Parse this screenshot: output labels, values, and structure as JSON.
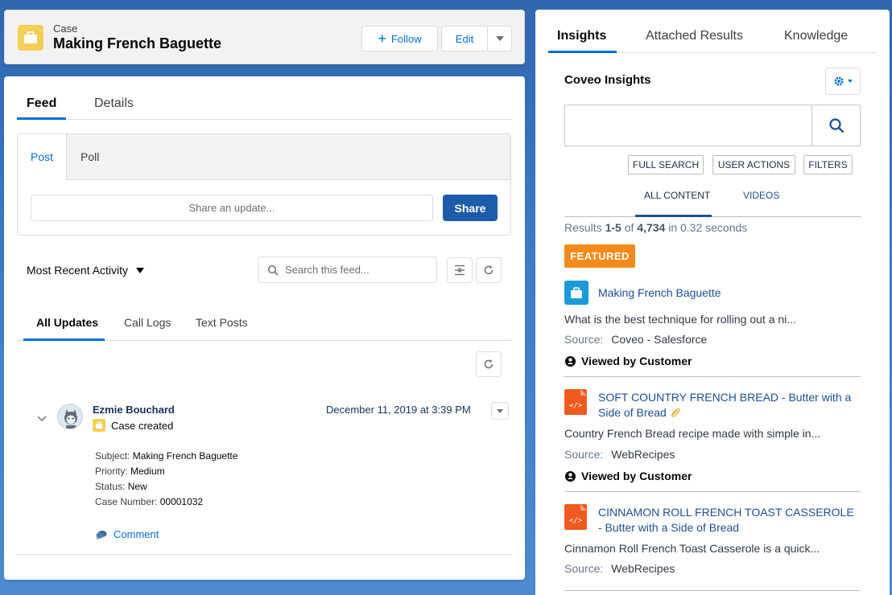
{
  "header": {
    "object_label": "Case",
    "record_title": "Making French Baguette",
    "follow_label": "Follow",
    "edit_label": "Edit"
  },
  "left": {
    "tabs": [
      "Feed",
      "Details"
    ],
    "publisher_tabs": [
      "Post",
      "Poll"
    ],
    "share_placeholder": "Share an update...",
    "share_label": "Share",
    "sort_label": "Most Recent Activity",
    "search_placeholder": "Search this feed...",
    "filter_tabs": [
      "All Updates",
      "Call Logs",
      "Text Posts"
    ],
    "feed_item": {
      "author": "Ezmie Bouchard",
      "action": "Case created",
      "timestamp": "December 11, 2019 at 3:39 PM",
      "fields": [
        {
          "label": "Subject:",
          "value": "Making French Baguette"
        },
        {
          "label": "Priority:",
          "value": "Medium"
        },
        {
          "label": "Status:",
          "value": "New"
        },
        {
          "label": "Case Number:",
          "value": "00001032"
        }
      ],
      "comment_label": "Comment"
    }
  },
  "right": {
    "tabs": [
      "Insights",
      "Attached Results",
      "Knowledge"
    ],
    "panel_title": "Coveo Insights",
    "search_value": "",
    "action_buttons": [
      "FULL SEARCH",
      "USER ACTIONS",
      "FILTERS"
    ],
    "content_tabs": [
      "ALL CONTENT",
      "VIDEOS"
    ],
    "results_summary": {
      "prefix": "Results ",
      "range": "1-5",
      "of": " of ",
      "total": "4,734",
      "suffix": " in 0.32 seconds"
    },
    "featured_label": "FEATURED",
    "source_label": "Source:",
    "results": [
      {
        "title": "Making French Baguette",
        "icon": "case-icon",
        "excerpt": "What is the best technique for rolling out a ni...",
        "source": "Coveo - Salesforce",
        "viewed": "Viewed by Customer"
      },
      {
        "title": "SOFT COUNTRY FRENCH BREAD - Butter with a Side of Bread",
        "icon": "html-file-icon",
        "excerpt": "Country French Bread recipe made with simple in...",
        "source": "WebRecipes",
        "viewed": "Viewed by Customer"
      },
      {
        "title": "CINNAMON ROLL FRENCH TOAST CASSEROLE - Butter with a Side of Bread",
        "icon": "html-file-icon",
        "excerpt": "Cinnamon Roll French Toast Casserole is a quick...",
        "source": "WebRecipes"
      }
    ]
  },
  "colors": {
    "brand": "#0070d2",
    "share_button": "#1d5bab",
    "featured": "#f38a1b",
    "case_icon": "#f4cf57",
    "html_icon": "#f05a1e"
  }
}
